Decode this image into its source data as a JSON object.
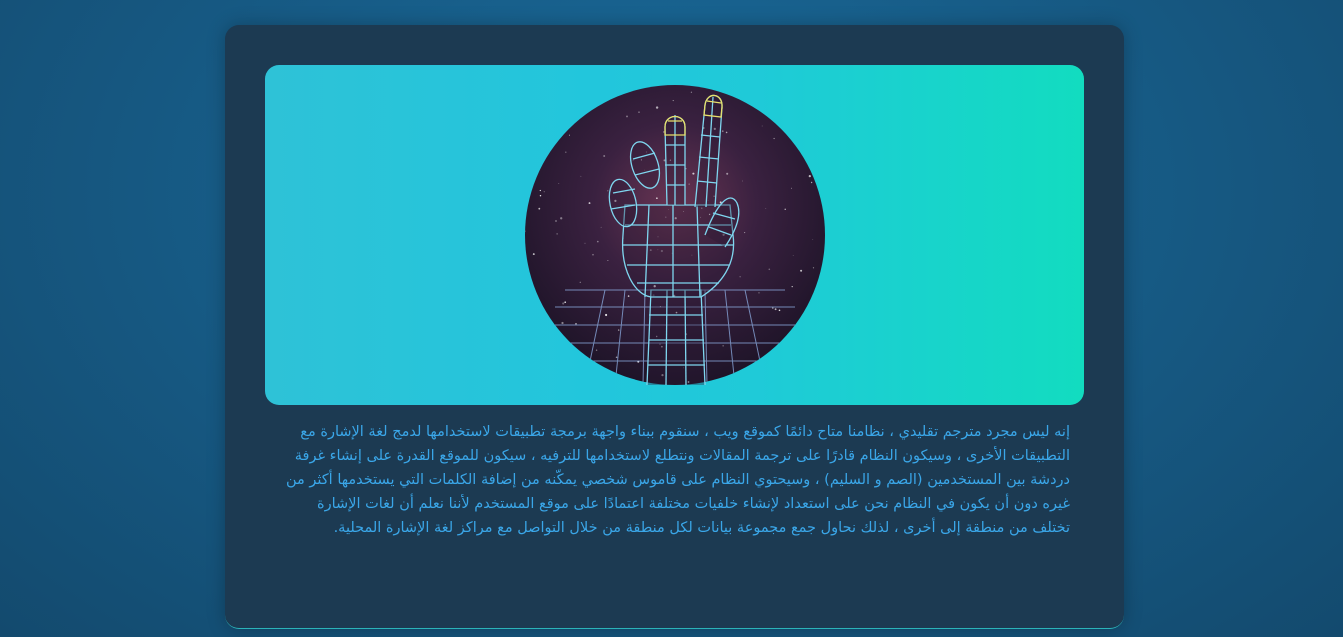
{
  "hero": {
    "image_icon": "peace-sign-wireframe-hand-icon",
    "colors": {
      "gradient_left": "#2ec2d7",
      "gradient_right": "#12dcc0",
      "circle_bg": "#2a1a35",
      "wire": "#7fd6ef",
      "wire_tip": "#e8e06a"
    }
  },
  "description": "إنه ليس مجرد مترجم تقليدي ، نظامنا متاح دائمًا كموقع ويب ، سنقوم ببناء واجهة برمجة تطبيقات لاستخدامها لدمج لغة الإشارة مع التطبيقات الأخرى ، وسيكون النظام قادرًا على ترجمة المقالات ونتطلع لاستخدامها للترفيه ، سيكون للموقع القدرة على إنشاء غرفة دردشة بين المستخدمين (الصم و السليم) ، وسيحتوي النظام على قاموس شخصي يمكّنه من إضافة الكلمات التي يستخدمها أكثر من غيره دون أن يكون في النظام نحن على استعداد لإنشاء خلفيات مختلفة اعتمادًا على موقع المستخدم لأننا نعلم أن لغات الإشارة تختلف من منطقة إلى أخرى ، لذلك نحاول جمع مجموعة بيانات لكل منطقة من خلال التواصل مع مراكز لغة الإشارة المحلية.",
  "theme": {
    "page_bg": "#175c87",
    "card_bg": "#1c3a52",
    "text_color": "#3aa6e8"
  }
}
